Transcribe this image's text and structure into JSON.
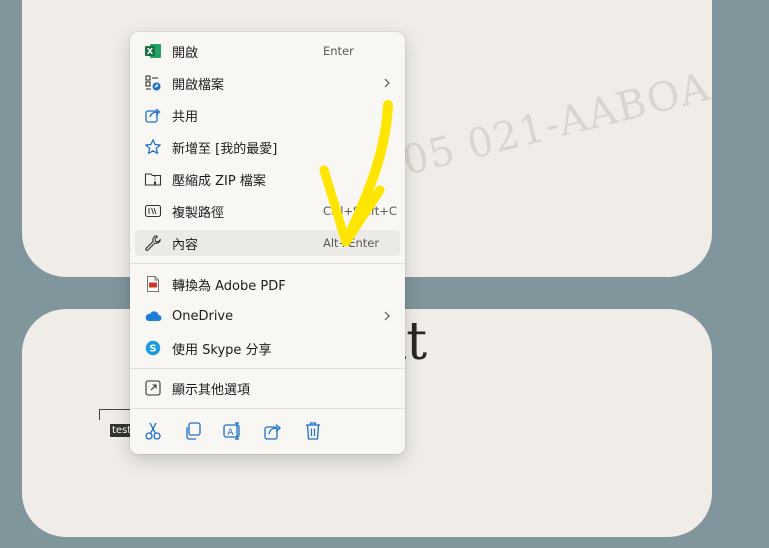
{
  "background": {
    "watermark_text": "05 021-AABOA",
    "heading_fragment": "rtant",
    "file_label": "test"
  },
  "menu": {
    "items": [
      {
        "label": "開啟",
        "shortcut": "Enter",
        "icon": "excel-icon"
      },
      {
        "label": "開啟檔案",
        "submenu": true,
        "icon": "open-with-icon"
      },
      {
        "label": "共用",
        "icon": "share-icon"
      },
      {
        "label": "新增至 [我的最愛]",
        "icon": "star-icon"
      },
      {
        "label": "壓縮成 ZIP 檔案",
        "icon": "zip-folder-icon"
      },
      {
        "label": "複製路徑",
        "shortcut": "Ctrl+Shift+C",
        "icon": "copy-path-icon"
      },
      {
        "label": "內容",
        "shortcut": "Alt+Enter",
        "icon": "wrench-icon",
        "highlighted": true
      },
      {
        "label": "轉換為 Adobe PDF",
        "icon": "pdf-icon"
      },
      {
        "label": "OneDrive",
        "submenu": true,
        "icon": "onedrive-icon"
      },
      {
        "label": "使用 Skype 分享",
        "icon": "skype-icon"
      },
      {
        "label": "顯示其他選項",
        "icon": "more-options-icon"
      }
    ],
    "quick_actions": [
      "cut-icon",
      "copy-icon",
      "rename-icon",
      "share-icon",
      "delete-icon"
    ]
  },
  "colors": {
    "accent": "#1b6fc8",
    "excel_green": "#1d7044",
    "annotation_arrow": "#ffe600",
    "pdf_red": "#d1352a"
  }
}
